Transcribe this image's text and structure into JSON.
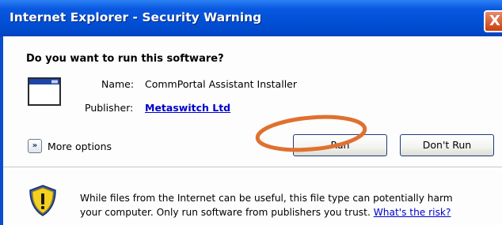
{
  "window": {
    "title": "Internet Explorer - Security Warning",
    "close_glyph": "X"
  },
  "prompt": {
    "question": "Do you want to run this software?"
  },
  "details": {
    "name_label": "Name:",
    "name_value": "CommPortal Assistant Installer",
    "publisher_label": "Publisher:",
    "publisher_value": "Metaswitch Ltd"
  },
  "options": {
    "more_glyph": "»",
    "more_label": "More options"
  },
  "buttons": {
    "run_label": "Run",
    "dont_run_label": "Don't Run"
  },
  "warning": {
    "line1": "While files from the Internet can be useful, this file type can potentially harm",
    "line2": "your computer. Only run software from publishers you trust.",
    "risk_link": "What's the risk?"
  },
  "colors": {
    "titlebar": "#0150d6",
    "annotation_circle": "#e07030",
    "link": "#0000cc"
  },
  "icons": {
    "application": "application-window-icon",
    "shield": "security-shield-warning-icon",
    "more": "expand-chevron-icon",
    "close": "close-icon"
  }
}
